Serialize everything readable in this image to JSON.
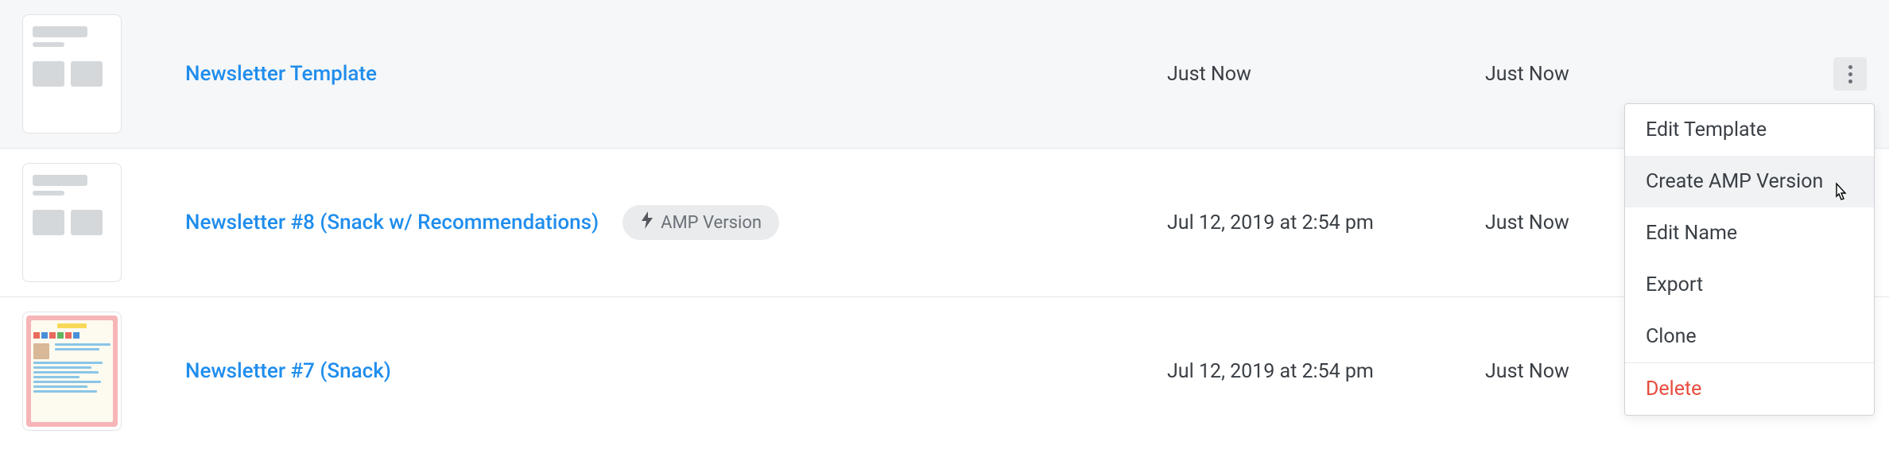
{
  "rows": [
    {
      "name": "Newsletter Template",
      "created": "Just Now",
      "updated": "Just Now",
      "amp": false,
      "thumb": "skeleton"
    },
    {
      "name": "Newsletter #8 (Snack w/ Recommendations)",
      "created": "Jul 12, 2019 at 2:54 pm",
      "updated": "Just Now",
      "amp": true,
      "thumb": "skeleton"
    },
    {
      "name": "Newsletter #7 (Snack)",
      "created": "Jul 12, 2019 at 2:54 pm",
      "updated": "Just Now",
      "amp": false,
      "thumb": "pink"
    }
  ],
  "ampBadgeLabel": "AMP Version",
  "menu": {
    "editTemplate": "Edit Template",
    "createAmp": "Create AMP Version",
    "editName": "Edit Name",
    "export": "Export",
    "clone": "Clone",
    "delete": "Delete"
  }
}
